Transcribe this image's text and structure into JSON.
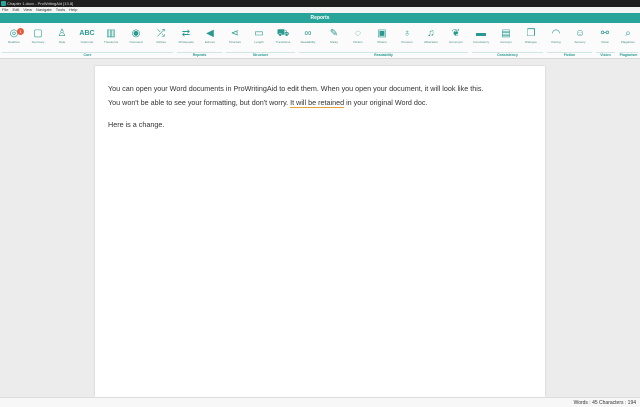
{
  "window": {
    "title": "Chapter 1.docx - ProWritingAid [13.8]"
  },
  "menu": [
    "File",
    "Edit",
    "View",
    "Navigate",
    "Tools",
    "Help"
  ],
  "reports_bar": {
    "title": "Reports"
  },
  "tools": [
    {
      "label": "Realtime",
      "icon": "realtime-icon",
      "glyph": "◎",
      "badge": "1"
    },
    {
      "label": "Summary",
      "icon": "summary-icon",
      "glyph": "▢"
    },
    {
      "label": "Style",
      "icon": "style-icon",
      "glyph": "♙"
    },
    {
      "label": "Grammar",
      "icon": "grammar-icon",
      "glyph": "ABC"
    },
    {
      "label": "Thesaurus",
      "icon": "thesaurus-icon",
      "glyph": "▥"
    },
    {
      "label": "Overused",
      "icon": "overused-icon",
      "glyph": "◉"
    },
    {
      "label": "Cliches",
      "icon": "cliches-icon",
      "glyph": "⤮"
    },
    {
      "label": "All Repeats",
      "icon": "all-repeats-icon",
      "glyph": "⇄"
    },
    {
      "label": "Echoes",
      "icon": "echoes-icon",
      "glyph": "◀"
    },
    {
      "label": "Structure",
      "icon": "structure-icon",
      "glyph": "⋖"
    },
    {
      "label": "Length",
      "icon": "length-icon",
      "glyph": "▭"
    },
    {
      "label": "Transitions",
      "icon": "transitions-icon",
      "glyph": "⛟"
    },
    {
      "label": "Readability",
      "icon": "readability-icon",
      "glyph": "∞"
    },
    {
      "label": "Sticky",
      "icon": "sticky-icon",
      "glyph": "✎"
    },
    {
      "label": "Diction",
      "icon": "diction-icon",
      "glyph": "◌"
    },
    {
      "label": "Writers",
      "icon": "writers-icon",
      "glyph": "▣"
    },
    {
      "label": "Pronoun",
      "icon": "pronoun-icon",
      "glyph": "♁"
    },
    {
      "label": "Alliteration",
      "icon": "alliteration-icon",
      "glyph": "♫"
    },
    {
      "label": "Homonym",
      "icon": "homonym-icon",
      "glyph": "❦"
    },
    {
      "label": "Consistency",
      "icon": "consistency-icon",
      "glyph": "▬"
    },
    {
      "label": "Acronym",
      "icon": "acronym-icon",
      "glyph": "▤"
    },
    {
      "label": "Dialogue",
      "icon": "dialogue-icon",
      "glyph": "❐"
    },
    {
      "label": "Pacing",
      "icon": "pacing-icon",
      "glyph": "◠"
    },
    {
      "label": "Sensory",
      "icon": "sensory-icon",
      "glyph": "☺"
    },
    {
      "label": "Vision",
      "icon": "vision-icon",
      "glyph": "⚯"
    },
    {
      "label": "Plagiarism",
      "icon": "plagiarism-icon",
      "glyph": "⌕"
    }
  ],
  "groups": [
    "Core",
    "Repeats",
    "Structure",
    "Readability",
    "Consistency",
    "Fiction",
    "Vision",
    "Plagiarism"
  ],
  "document": {
    "line1": "You can open your Word documents in ProWritingAid to edit them. When you open your document, it will look like this.",
    "line2_a": "You won't be able to see your formatting, but don't worry. ",
    "line2_flag": "It will be retained",
    "line2_b": " in your original Word doc.",
    "line3": "Here is a change."
  },
  "status": {
    "text": "Words : 45 Characters : 194"
  }
}
